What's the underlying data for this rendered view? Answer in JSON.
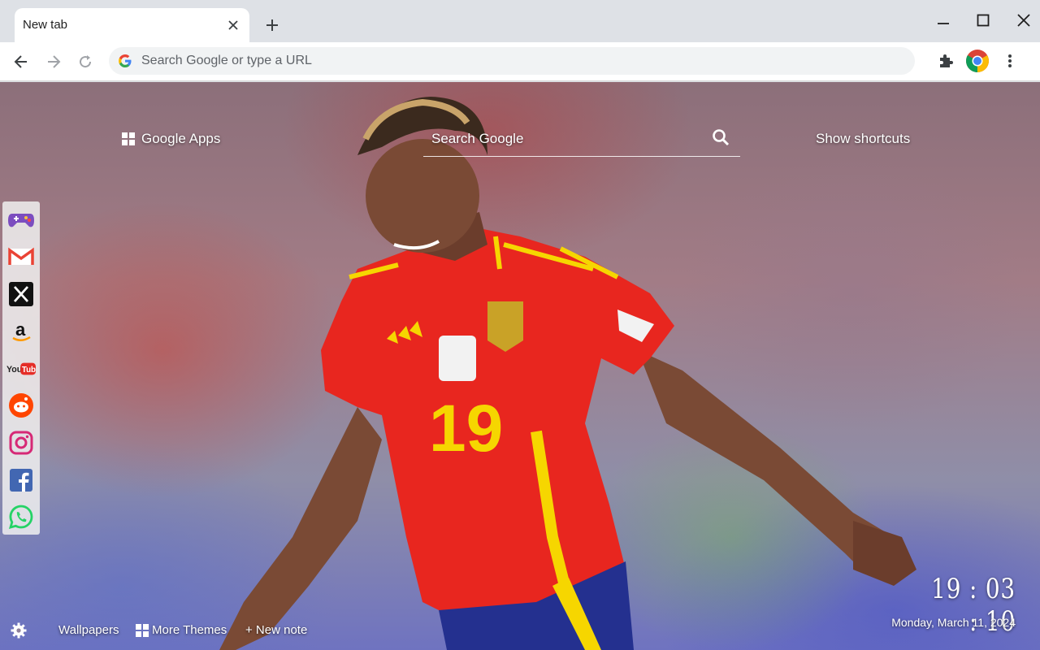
{
  "browser": {
    "tab": {
      "title": "New tab"
    },
    "omnibox": {
      "placeholder": "Search Google or type a URL"
    },
    "icons": {
      "back": "arrow-left-icon",
      "forward": "arrow-right-icon",
      "reload": "reload-icon",
      "extensions": "puzzle-icon",
      "profile": "chrome-logo-icon",
      "menu": "kebab-menu-icon"
    }
  },
  "newtab": {
    "google_apps": "Google Apps",
    "search_placeholder": "Search Google",
    "show_shortcuts": "Show shortcuts",
    "dock": [
      "games",
      "gmail",
      "x",
      "amazon",
      "youtube",
      "reddit",
      "instagram",
      "facebook",
      "whatsapp"
    ],
    "clock": {
      "time": "19 : 03 : 10",
      "date": "Monday, March 11, 2024"
    },
    "bottom": {
      "wallpapers": "Wallpapers",
      "more_themes": "More Themes",
      "new_note": "+ New note"
    },
    "wallpaper": {
      "shirt_number": "19"
    },
    "colors": {
      "shirt_red": "#e8261f",
      "shirt_yellow": "#f6d600",
      "shorts_blue": "#24308f"
    }
  }
}
